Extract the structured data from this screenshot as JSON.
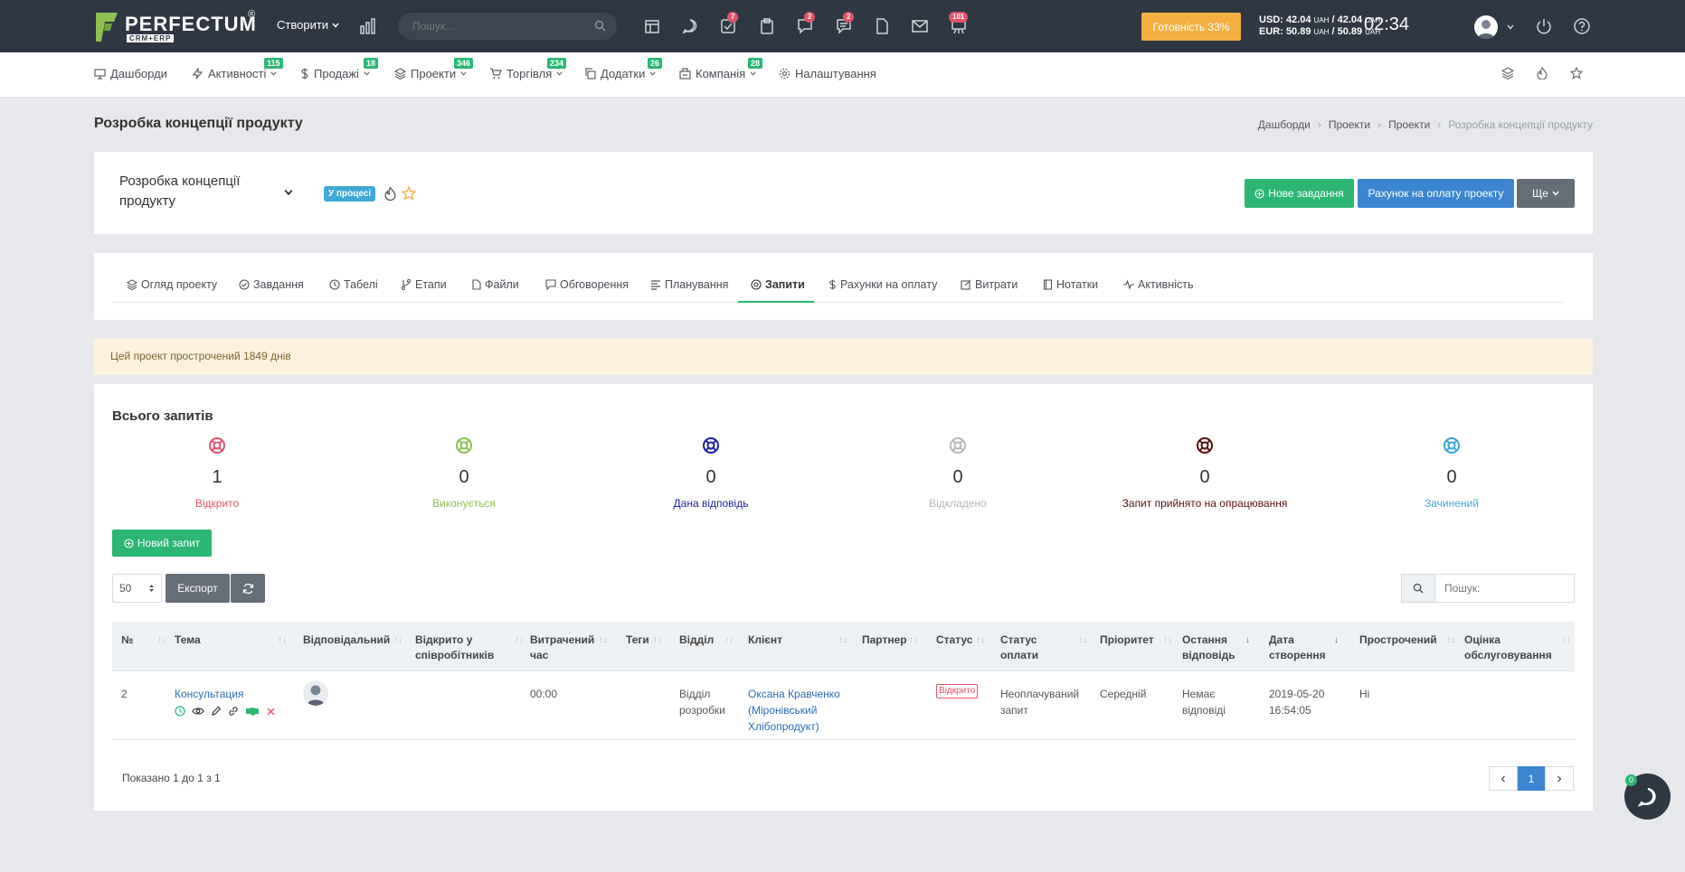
{
  "topbar": {
    "logo_text": "PERFECTUM",
    "logo_sub": "CRM+ERP",
    "logo_reg": "®",
    "create_label": "Створити",
    "search_placeholder": "Пошук...",
    "badges": [
      "7",
      "2",
      "2",
      "101"
    ],
    "ready_label": "Готовність 33%",
    "currency_usd_label": "USD: 42.04",
    "currency_usd_value": "42.04",
    "currency_eur_label": "EUR: 50.89",
    "currency_eur_value": "50.89",
    "currency_unit": "UAH",
    "clock": "02:34",
    "accent": "#f4b142"
  },
  "nav": {
    "items": [
      {
        "label": "Дашборди",
        "icon": "monitor-icon",
        "badge": ""
      },
      {
        "label": "Активності",
        "icon": "bolt-icon",
        "badge": "115"
      },
      {
        "label": "Продажі",
        "icon": "dollar-icon",
        "badge": "18"
      },
      {
        "label": "Проекти",
        "icon": "layers-icon",
        "badge": "346"
      },
      {
        "label": "Торгівля",
        "icon": "cart-icon",
        "badge": "234"
      },
      {
        "label": "Додатки",
        "icon": "copy-icon",
        "badge": "26"
      },
      {
        "label": "Компанія",
        "icon": "building-icon",
        "badge": "28"
      },
      {
        "label": "Налаштування",
        "icon": "gear-icon",
        "badge": ""
      }
    ]
  },
  "page": {
    "title": "Розробка концепції продукту",
    "breadcrumb": [
      "Дашборди",
      "Проекти",
      "Проекти",
      "Розробка концепції продукту"
    ]
  },
  "project": {
    "name": "Розробка концепції продукту",
    "status": "У процесі",
    "new_task_label": "Нове завдання",
    "invoice_label": "Рахунок на оплату проекту",
    "more_label": "Ще"
  },
  "tabs": [
    {
      "label": "Огляд проекту",
      "icon": "layers-icon"
    },
    {
      "label": "Завдання",
      "icon": "check-circle-icon"
    },
    {
      "label": "Табелі",
      "icon": "clock-icon"
    },
    {
      "label": "Етапи",
      "icon": "branch-icon"
    },
    {
      "label": "Файли",
      "icon": "file-icon"
    },
    {
      "label": "Обговорення",
      "icon": "chat-icon"
    },
    {
      "label": "Планування",
      "icon": "list-icon"
    },
    {
      "label": "Запити",
      "icon": "lifebuoy-icon"
    },
    {
      "label": "Рахунки на оплату",
      "icon": "dollar-icon"
    },
    {
      "label": "Витрати",
      "icon": "edit-icon"
    },
    {
      "label": "Нотатки",
      "icon": "book-icon"
    },
    {
      "label": "Активність",
      "icon": "pulse-icon"
    }
  ],
  "alert": "Цей проект прострочений 1849 днів",
  "requests": {
    "title": "Всього запитів",
    "stats": [
      {
        "label": "Відкрито",
        "value": "1",
        "color": "#e3536a"
      },
      {
        "label": "Виконується",
        "value": "0",
        "color": "#8cc152"
      },
      {
        "label": "Дана відповідь",
        "value": "0",
        "color": "#1f1fa8"
      },
      {
        "label": "Відкладено",
        "value": "0",
        "color": "#b5b8bb"
      },
      {
        "label": "Запит прийнято на опрацювання",
        "value": "0",
        "color": "#5a1010"
      },
      {
        "label": "Зачинений",
        "value": "0",
        "color": "#3fa8d8"
      }
    ],
    "new_request_label": "Новий запит",
    "page_size": "50",
    "export_label": "Експорт",
    "search_placeholder": "Пошук:",
    "columns": [
      "№",
      "Тема",
      "Відповідальний",
      "Відкрито у співробітників",
      "Витрачений час",
      "Теги",
      "Відділ",
      "Клієнт",
      "Партнер",
      "Статус",
      "Статус оплати",
      "Пріоритет",
      "Остання відповідь",
      "Дата створення",
      "Прострочений",
      "Оцінка обслуговування"
    ],
    "row": {
      "num": "2",
      "topic": "Консультация",
      "time": "00:00",
      "department": "Відділ розробки",
      "client": "Оксана Кравченко (Міронівський Хлібопродукт)",
      "status": "Відкрито",
      "payment_status": "Неоплачуваний запит",
      "priority": "Середній",
      "last_reply": "Немає відповіді",
      "created": "2019-05-20 16:54:05",
      "overdue": "Ні"
    },
    "footer": "Показано 1 до 1 з 1",
    "current_page": "1"
  },
  "chat_badge": "0"
}
